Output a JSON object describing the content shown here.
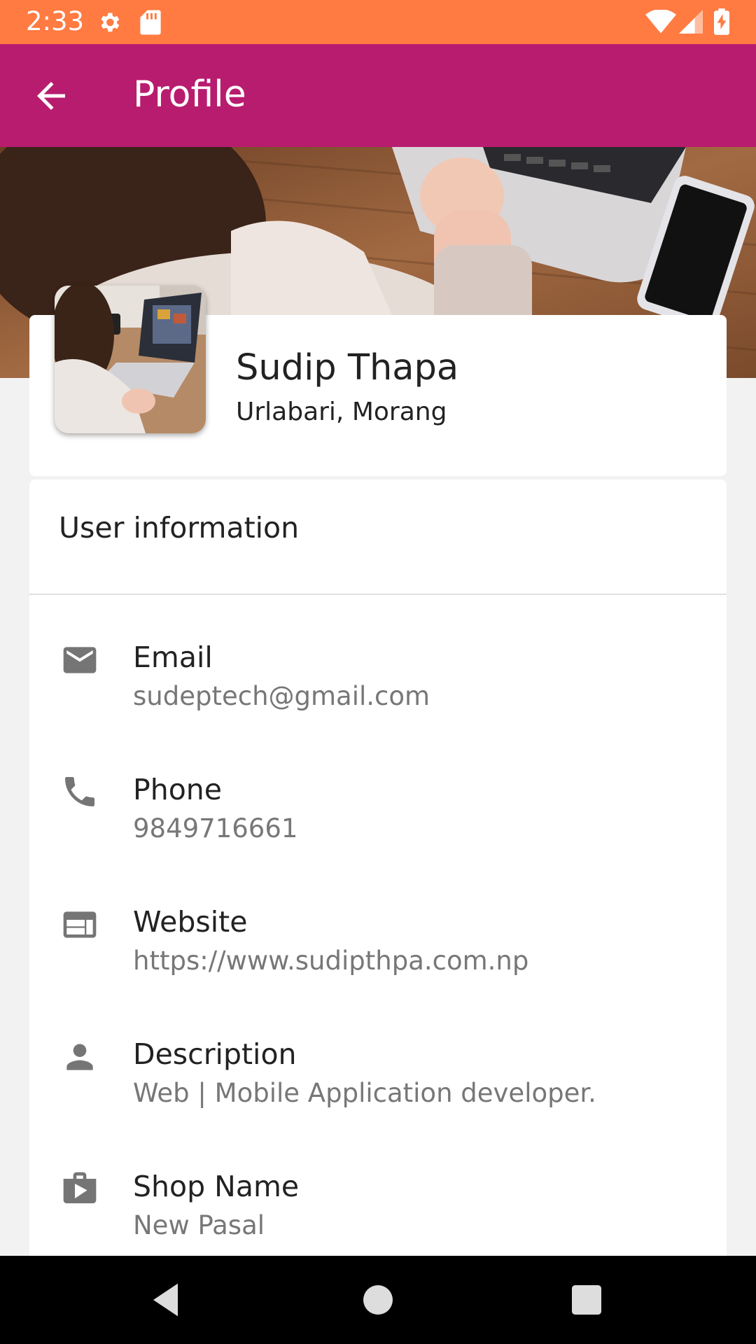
{
  "status_bar": {
    "time": "2:33",
    "icons": [
      "gear-icon",
      "sd-card-icon",
      "wifi-icon",
      "signal-icon",
      "battery-charging-icon"
    ]
  },
  "app_bar": {
    "title": "Profile",
    "back_icon": "arrow-back-icon",
    "color": "#b81c6f"
  },
  "profile": {
    "name": "Sudip Thapa",
    "location": "Urlabari, Morang"
  },
  "user_info": {
    "header": "User information",
    "items": [
      {
        "icon": "email-icon",
        "label": "Email",
        "value": "sudeptech@gmail.com"
      },
      {
        "icon": "phone-icon",
        "label": "Phone",
        "value": "9849716661"
      },
      {
        "icon": "web-icon",
        "label": "Website",
        "value": "https://www.sudipthpa.com.np"
      },
      {
        "icon": "person-icon",
        "label": "Description",
        "value": "Web | Mobile Application developer."
      },
      {
        "icon": "shop-icon",
        "label": "Shop Name",
        "value": "New Pasal"
      }
    ]
  },
  "nav_bar": {
    "icons": [
      "back-triangle-icon",
      "home-circle-icon",
      "recents-square-icon"
    ]
  },
  "colors": {
    "status_bar": "#ff7b41",
    "app_bar": "#b81c6f",
    "background": "#f2f2f2",
    "icon_gray": "#757575"
  }
}
